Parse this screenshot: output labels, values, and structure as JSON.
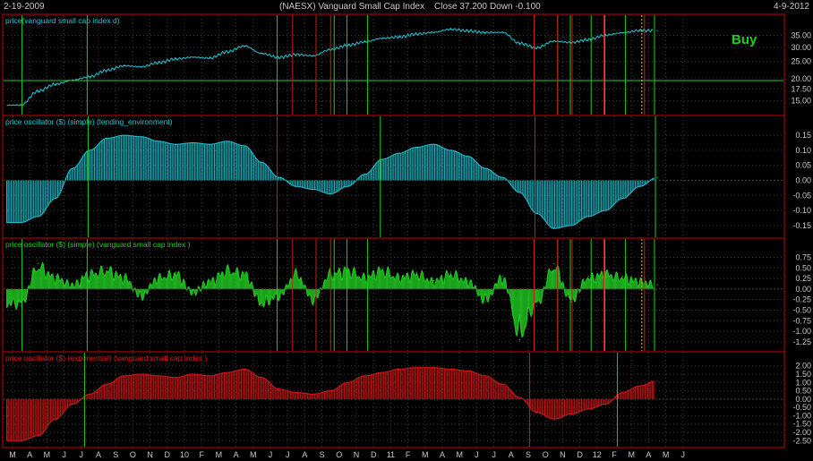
{
  "header": {
    "start_date": "2-19-2009",
    "title": "(NAESX)  Vanguard Small Cap Index",
    "close": "Close 37.200",
    "change": "Down -0.100",
    "end_date": "4-9-2012"
  },
  "colors": {
    "background": "#000000",
    "frame": "#cc0000",
    "grid": "#3c3c3c",
    "price_line": "#22c6d6",
    "lending": "#22c6d6",
    "simple": "#22cc22",
    "exponential": "#e01818",
    "buy_line": "#22cc22",
    "sell_line": "#cc1c1c",
    "signal_dotted": "#e0a020",
    "horizontal_line": "#22cc22"
  },
  "chart_data": [
    {
      "type": "line",
      "title": "price(vanguard small cap index  d)",
      "annotation": "Buy",
      "y_ticks": [
        "35.00",
        "30.00",
        "25.00",
        "20.00",
        "17.50",
        "15.00"
      ],
      "ylim": [
        13,
        40
      ],
      "log_scale": true,
      "horizontal_line_value": 19.5,
      "x": [
        "2009-03",
        "2009-04",
        "2009-05",
        "2009-06",
        "2009-07",
        "2009-08",
        "2009-09",
        "2009-10",
        "2009-11",
        "2009-12",
        "2010-01",
        "2010-02",
        "2010-03",
        "2010-04",
        "2010-05",
        "2010-06",
        "2010-07",
        "2010-08",
        "2010-09",
        "2010-10",
        "2010-11",
        "2010-12",
        "2011-01",
        "2011-02",
        "2011-03",
        "2011-04",
        "2011-05",
        "2011-06",
        "2011-07",
        "2011-08",
        "2011-09",
        "2011-10",
        "2011-11",
        "2011-12",
        "2012-01",
        "2012-02",
        "2012-03",
        "2012-04"
      ],
      "values": [
        14.2,
        17.0,
        18.6,
        19.6,
        20.5,
        22.3,
        23.6,
        23.3,
        24.6,
        25.8,
        26.4,
        26.1,
        28.3,
        30.5,
        27.7,
        26.3,
        27.3,
        26.9,
        29.1,
        30.8,
        32.2,
        33.7,
        34.3,
        35.6,
        36.4,
        37.9,
        37.1,
        36.3,
        36.4,
        31.6,
        29.8,
        32.5,
        31.9,
        33.1,
        35.1,
        36.2,
        37.3,
        37.2
      ]
    },
    {
      "type": "bar",
      "title": "price oscillator ($) (simple) (lending_environment)",
      "y_ticks": [
        "0.15",
        "0.10",
        "0.05",
        "0.00",
        "-0.05",
        "-0.10",
        "-0.15"
      ],
      "ylim": [
        -0.18,
        0.18
      ],
      "x": [
        "2009-03",
        "2009-04",
        "2009-05",
        "2009-06",
        "2009-07",
        "2009-08",
        "2009-09",
        "2009-10",
        "2009-11",
        "2009-12",
        "2010-01",
        "2010-02",
        "2010-03",
        "2010-04",
        "2010-05",
        "2010-06",
        "2010-07",
        "2010-08",
        "2010-09",
        "2010-10",
        "2010-11",
        "2010-12",
        "2011-01",
        "2011-02",
        "2011-03",
        "2011-04",
        "2011-05",
        "2011-06",
        "2011-07",
        "2011-08",
        "2011-09",
        "2011-10",
        "2011-11",
        "2011-12",
        "2012-01",
        "2012-02",
        "2012-03",
        "2012-04"
      ],
      "values": [
        -0.14,
        -0.12,
        -0.06,
        0.04,
        0.1,
        0.14,
        0.15,
        0.145,
        0.13,
        0.12,
        0.125,
        0.12,
        0.13,
        0.115,
        0.06,
        0.01,
        -0.02,
        -0.03,
        -0.045,
        -0.02,
        0.02,
        0.07,
        0.09,
        0.11,
        0.12,
        0.1,
        0.08,
        0.04,
        0.01,
        -0.04,
        -0.11,
        -0.16,
        -0.15,
        -0.12,
        -0.1,
        -0.06,
        -0.02,
        0.01
      ]
    },
    {
      "type": "bar",
      "title": "price oscillator ($) (simple) (vanguard small cap index )",
      "y_ticks": [
        "0.75",
        "0.50",
        "0.25",
        "0.00",
        "-0.25",
        "-0.50",
        "-0.75",
        "-1.00",
        "-1.25"
      ],
      "ylim": [
        -1.4,
        0.95
      ],
      "x": [
        "2009-03",
        "2009-04",
        "2009-05",
        "2009-06",
        "2009-07",
        "2009-08",
        "2009-09",
        "2009-10",
        "2009-11",
        "2009-12",
        "2010-01",
        "2010-02",
        "2010-03",
        "2010-04",
        "2010-05",
        "2010-06",
        "2010-07",
        "2010-08",
        "2010-09",
        "2010-10",
        "2010-11",
        "2010-12",
        "2011-01",
        "2011-02",
        "2011-03",
        "2011-04",
        "2011-05",
        "2011-06",
        "2011-07",
        "2011-08",
        "2011-09",
        "2011-10",
        "2011-11",
        "2011-12",
        "2012-01",
        "2012-02",
        "2012-03",
        "2012-04"
      ],
      "values": [
        -0.4,
        0.6,
        0.3,
        0.1,
        0.4,
        0.5,
        0.3,
        -0.2,
        0.3,
        0.4,
        -0.1,
        0.2,
        0.5,
        0.4,
        -0.4,
        -0.2,
        0.4,
        -0.3,
        0.4,
        0.5,
        0.3,
        0.5,
        0.3,
        0.4,
        0.2,
        0.4,
        0.2,
        -0.3,
        0.3,
        -1.2,
        -0.4,
        0.6,
        -0.3,
        0.3,
        0.4,
        0.3,
        0.2,
        0.1
      ]
    },
    {
      "type": "bar",
      "title": "price oscillator ($) (exponential) (vanguard small cap index )",
      "y_ticks": [
        "2.00",
        "1.50",
        "1.00",
        "0.50",
        "0.00",
        "-0.50",
        "-1.00",
        "-1.50",
        "-2.00",
        "-2.50"
      ],
      "ylim": [
        -2.7,
        2.2
      ],
      "x": [
        "2009-03",
        "2009-04",
        "2009-05",
        "2009-06",
        "2009-07",
        "2009-08",
        "2009-09",
        "2009-10",
        "2009-11",
        "2009-12",
        "2010-01",
        "2010-02",
        "2010-03",
        "2010-04",
        "2010-05",
        "2010-06",
        "2010-07",
        "2010-08",
        "2010-09",
        "2010-10",
        "2010-11",
        "2010-12",
        "2011-01",
        "2011-02",
        "2011-03",
        "2011-04",
        "2011-05",
        "2011-06",
        "2011-07",
        "2011-08",
        "2011-09",
        "2011-10",
        "2011-11",
        "2011-12",
        "2012-01",
        "2012-02",
        "2012-03",
        "2012-04"
      ],
      "values": [
        -2.5,
        -2.2,
        -1.2,
        -0.3,
        0.3,
        0.9,
        1.4,
        1.5,
        1.4,
        1.3,
        1.5,
        1.4,
        1.6,
        1.8,
        1.3,
        0.6,
        0.4,
        0.3,
        0.5,
        1.0,
        1.4,
        1.6,
        1.8,
        1.9,
        1.9,
        1.8,
        1.7,
        1.4,
        0.9,
        0.1,
        -0.8,
        -1.2,
        -0.9,
        -0.6,
        -0.3,
        0.4,
        0.8,
        1.1
      ]
    }
  ],
  "signals": {
    "buy": [
      "2009-03",
      "2009-07",
      "2010-06",
      "2010-09",
      "2010-10",
      "2010-11",
      "2011-09",
      "2011-10",
      "2011-11",
      "2011-12",
      "2012-01",
      "2012-02",
      "2012-04"
    ],
    "sell": [
      "2010-07",
      "2010-08",
      "2010-09",
      "2011-09",
      "2011-10",
      "2011-11",
      "2012-01",
      "2012-03"
    ],
    "dotted": "2012-03"
  },
  "x_axis": {
    "labels": [
      "M",
      "A",
      "M",
      "J",
      "J",
      "A",
      "S",
      "O",
      "N",
      "D",
      "10",
      "F",
      "M",
      "A",
      "M",
      "J",
      "J",
      "A",
      "S",
      "O",
      "N",
      "D",
      "11",
      "F",
      "M",
      "A",
      "M",
      "J",
      "J",
      "A",
      "S",
      "O",
      "N",
      "D",
      "12",
      "F",
      "M",
      "A",
      "M",
      "J"
    ]
  }
}
